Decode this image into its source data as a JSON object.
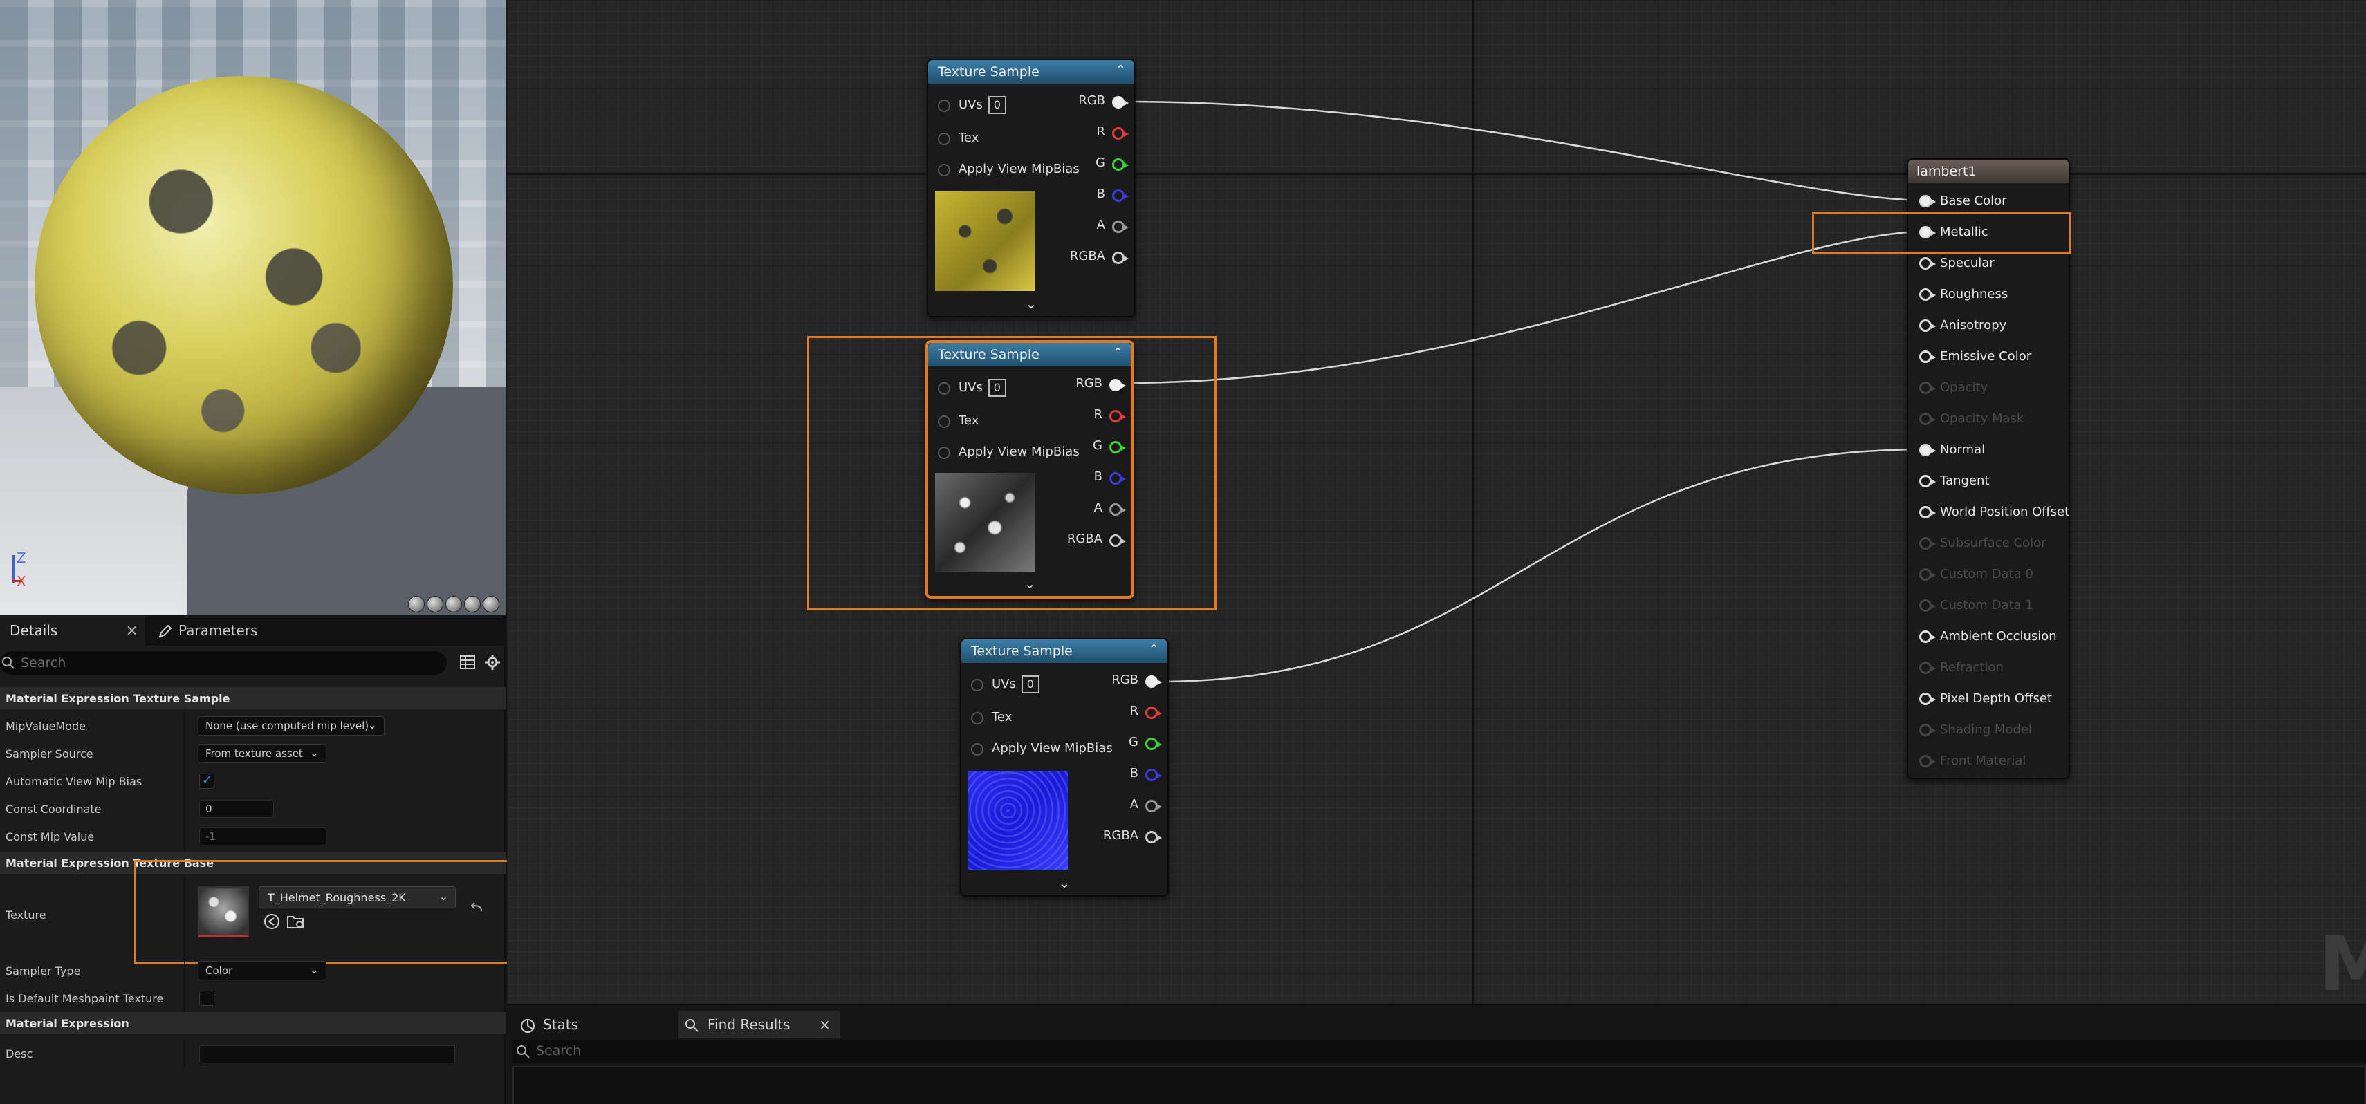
{
  "viewport": {
    "axis_z": "Z",
    "axis_x": "X"
  },
  "details": {
    "tabs": {
      "details": "Details",
      "details_close": "×",
      "parameters": "Parameters"
    },
    "search_placeholder": "Search",
    "sections": {
      "texture_sample": "Material Expression Texture Sample",
      "texture_base": "Material Expression Texture Base",
      "expression": "Material Expression"
    },
    "props": {
      "mip_value_mode": {
        "label": "MipValueMode",
        "value": "None (use computed mip level)"
      },
      "sampler_source": {
        "label": "Sampler Source",
        "value": "From texture asset"
      },
      "auto_view_mip_bias": {
        "label": "Automatic View Mip Bias",
        "checked": true
      },
      "const_coordinate": {
        "label": "Const Coordinate",
        "value": "0"
      },
      "const_mip_value": {
        "label": "Const Mip Value",
        "value": "-1"
      },
      "texture": {
        "label": "Texture",
        "value": "T_Helmet_Roughness_2K"
      },
      "sampler_type": {
        "label": "Sampler Type",
        "value": "Color"
      },
      "is_default_meshpaint": {
        "label": "Is Default Meshpaint Texture",
        "checked": false
      },
      "desc": {
        "label": "Desc",
        "value": ""
      }
    }
  },
  "graph": {
    "watermark": "M",
    "texture_nodes": [
      {
        "title": "Texture Sample",
        "uvs": "UVs",
        "uv_index": "0",
        "tex": "Tex",
        "mip": "Apply View MipBias",
        "outputs": [
          "RGB",
          "R",
          "G",
          "B",
          "A",
          "RGBA"
        ],
        "thumb": "yellow",
        "selected": false
      },
      {
        "title": "Texture Sample",
        "uvs": "UVs",
        "uv_index": "0",
        "tex": "Tex",
        "mip": "Apply View MipBias",
        "outputs": [
          "RGB",
          "R",
          "G",
          "B",
          "A",
          "RGBA"
        ],
        "thumb": "gray",
        "selected": true
      },
      {
        "title": "Texture Sample",
        "uvs": "UVs",
        "uv_index": "0",
        "tex": "Tex",
        "mip": "Apply View MipBias",
        "outputs": [
          "RGB",
          "R",
          "G",
          "B",
          "A",
          "RGBA"
        ],
        "thumb": "blue",
        "selected": false
      }
    ],
    "result_node": {
      "title": "lambert1",
      "inputs": [
        {
          "label": "Base Color",
          "enabled": true,
          "connected": true
        },
        {
          "label": "Metallic",
          "enabled": true,
          "connected": true
        },
        {
          "label": "Specular",
          "enabled": true,
          "connected": false
        },
        {
          "label": "Roughness",
          "enabled": true,
          "connected": false
        },
        {
          "label": "Anisotropy",
          "enabled": true,
          "connected": false
        },
        {
          "label": "Emissive Color",
          "enabled": true,
          "connected": false
        },
        {
          "label": "Opacity",
          "enabled": false,
          "connected": false
        },
        {
          "label": "Opacity Mask",
          "enabled": false,
          "connected": false
        },
        {
          "label": "Normal",
          "enabled": true,
          "connected": true
        },
        {
          "label": "Tangent",
          "enabled": true,
          "connected": false
        },
        {
          "label": "World Position Offset",
          "enabled": true,
          "connected": false
        },
        {
          "label": "Subsurface Color",
          "enabled": false,
          "connected": false
        },
        {
          "label": "Custom Data 0",
          "enabled": false,
          "connected": false
        },
        {
          "label": "Custom Data 1",
          "enabled": false,
          "connected": false
        },
        {
          "label": "Ambient Occlusion",
          "enabled": true,
          "connected": false
        },
        {
          "label": "Refraction",
          "enabled": false,
          "connected": false
        },
        {
          "label": "Pixel Depth Offset",
          "enabled": true,
          "connected": false
        },
        {
          "label": "Shading Model",
          "enabled": false,
          "connected": false
        },
        {
          "label": "Front Material",
          "enabled": false,
          "connected": false
        }
      ]
    }
  },
  "bottom": {
    "tabs": {
      "stats": "Stats",
      "find_results": "Find Results",
      "find_close": "×"
    },
    "search_placeholder": "Search"
  },
  "colors": {
    "accent": "#e07b22",
    "node_header": "#2f6f96",
    "result_header": "#5a4f48",
    "pin_r": "#e03a3a",
    "pin_g": "#3ad13a",
    "pin_b": "#3a3ae0"
  }
}
